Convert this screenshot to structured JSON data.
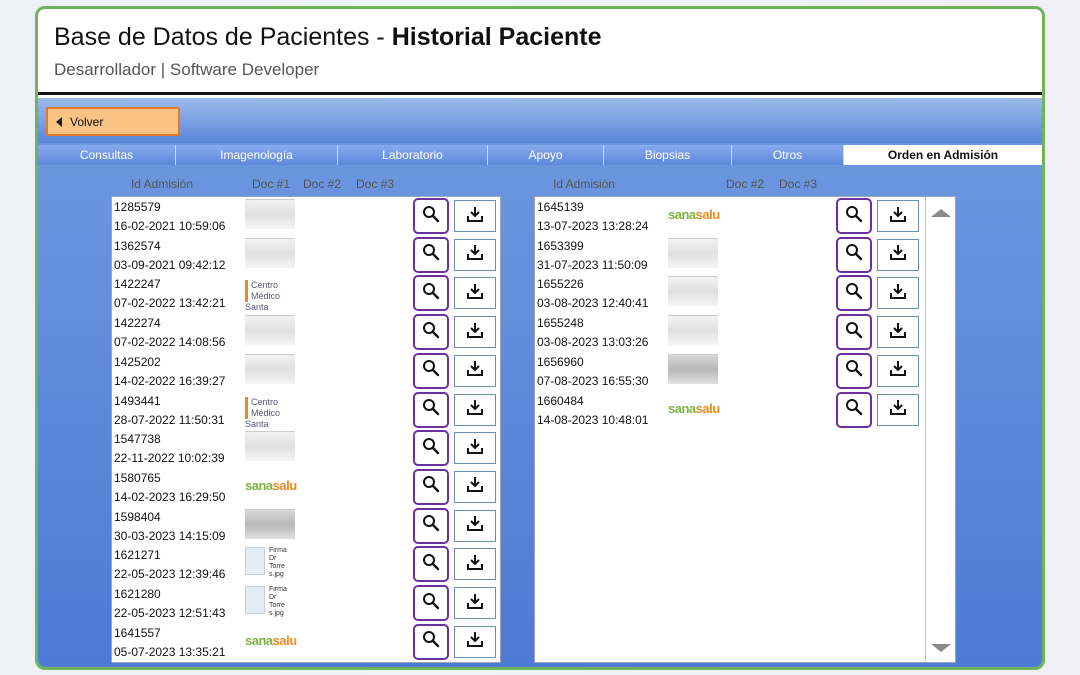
{
  "header": {
    "title_prefix": "Base de Datos de Pacientes - ",
    "title_bold": "Historial Paciente",
    "subtitle": "Desarrollador | Software Developer"
  },
  "toolbar": {
    "back_label": "Volver"
  },
  "tabs": [
    {
      "label": "Consultas",
      "active": false
    },
    {
      "label": "Imagenología",
      "active": false
    },
    {
      "label": "Laboratorio",
      "active": false
    },
    {
      "label": "Apoyo",
      "active": false
    },
    {
      "label": "Biopsias",
      "active": false
    },
    {
      "label": "Otros",
      "active": false
    },
    {
      "label": "Orden en Admisión",
      "active": true
    }
  ],
  "left_table": {
    "headers": {
      "id": "Id Admisión",
      "doc1": "Doc #1",
      "doc2": "Doc #2",
      "doc3": "Doc #3"
    },
    "rows": [
      {
        "id": "1285579",
        "date": "16-02-2021 10:59:06",
        "thumb": "doc"
      },
      {
        "id": "1362574",
        "date": "03-09-2021 09:42:12",
        "thumb": "doc"
      },
      {
        "id": "1422247",
        "date": "07-02-2022 13:42:21",
        "thumb": "cmsc"
      },
      {
        "id": "1422274",
        "date": "07-02-2022 14:08:56",
        "thumb": "doc"
      },
      {
        "id": "1425202",
        "date": "14-02-2022 16:39:27",
        "thumb": "doc"
      },
      {
        "id": "1493441",
        "date": "28-07-2022 11:50:31",
        "thumb": "cmsc"
      },
      {
        "id": "1547738",
        "date": "22-11-2022 10:02:39",
        "thumb": "doc"
      },
      {
        "id": "1580765",
        "date": "14-02-2023 16:29:50",
        "thumb": "sana"
      },
      {
        "id": "1598404",
        "date": "30-03-2023 14:15:09",
        "thumb": "docdark"
      },
      {
        "id": "1621271",
        "date": "22-05-2023 12:39:46",
        "thumb": "file"
      },
      {
        "id": "1621280",
        "date": "22-05-2023 12:51:43",
        "thumb": "file"
      },
      {
        "id": "1641557",
        "date": "05-07-2023 13:35:21",
        "thumb": "sana"
      }
    ]
  },
  "right_table": {
    "headers": {
      "id": "Id Admisión",
      "doc2": "Doc #2",
      "doc3": "Doc #3"
    },
    "rows": [
      {
        "id": "1645139",
        "date": "13-07-2023 13:28:24",
        "thumb": "sana"
      },
      {
        "id": "1653399",
        "date": "31-07-2023 11:50:09",
        "thumb": "doc"
      },
      {
        "id": "1655226",
        "date": "03-08-2023 12:40:41",
        "thumb": "doc"
      },
      {
        "id": "1655248",
        "date": "03-08-2023 13:03:26",
        "thumb": "doc"
      },
      {
        "id": "1656960",
        "date": "07-08-2023 16:55:30",
        "thumb": "docdark"
      },
      {
        "id": "1660484",
        "date": "14-08-2023 10:48:01",
        "thumb": "sana"
      }
    ]
  },
  "logos": {
    "cmsc_line1": "Centro Médico",
    "cmsc_line2": "Santa Catalina",
    "sana_a": "sana",
    "sana_b": "salud"
  },
  "file_thumb": {
    "l1": "Firma",
    "l2": "Dr",
    "l3": "Torre",
    "l4": "s.jpg"
  },
  "icons": {
    "search": "magnifier-icon",
    "download": "download-icon"
  },
  "colors": {
    "accent_purple": "#6b2fa0",
    "back_orange": "#f9c484",
    "frame_green": "#6fb35a"
  }
}
